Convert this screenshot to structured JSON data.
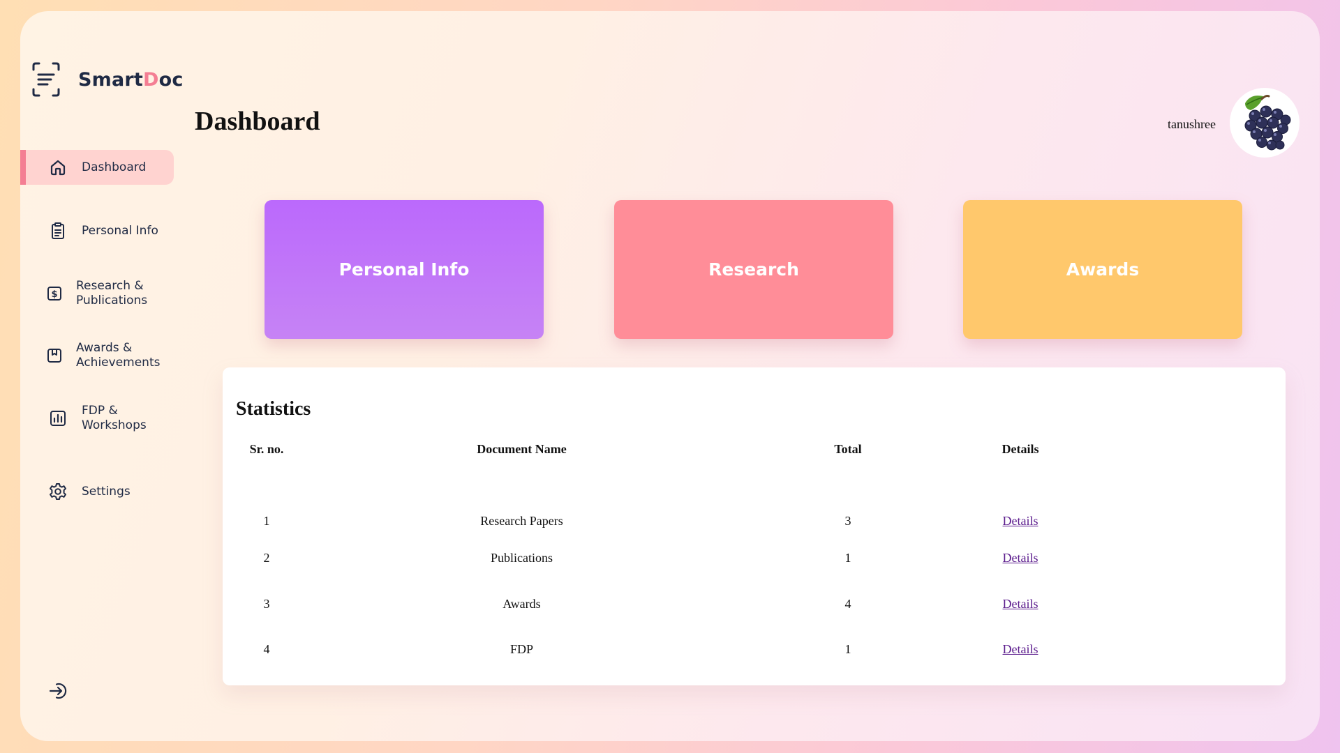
{
  "brand": {
    "name_part1": "Smart",
    "name_accent": "D",
    "name_part2": "oc"
  },
  "sidebar": {
    "items": [
      {
        "label": "Dashboard",
        "icon": "home-icon",
        "active": true
      },
      {
        "label": "Personal Info",
        "icon": "clipboard-icon",
        "active": false
      },
      {
        "label_line1": "Research &",
        "label_line2": "Publications",
        "icon": "dollar-document-icon",
        "active": false
      },
      {
        "label_line1": "Awards &",
        "label_line2": "Achievements",
        "icon": "bookmark-box-icon",
        "active": false
      },
      {
        "label_line1": "FDP &",
        "label_line2": "Workshops",
        "icon": "bar-chart-icon",
        "active": false
      },
      {
        "label": "Settings",
        "icon": "gear-icon",
        "active": false
      }
    ],
    "logout_icon": "logout-icon"
  },
  "header": {
    "title": "Dashboard",
    "username": "tanushree",
    "avatar_icon": "grapes-avatar"
  },
  "cards": [
    {
      "label": "Personal Info",
      "color": "#bb69fc"
    },
    {
      "label": "Research",
      "color": "#ff8d98"
    },
    {
      "label": "Awards",
      "color": "#ffc86c"
    }
  ],
  "statistics": {
    "title": "Statistics",
    "columns": [
      "Sr. no.",
      "Document Name",
      "Total",
      "Details"
    ],
    "rows": [
      {
        "sr": "1",
        "name": "Research Papers",
        "total": "3",
        "details": "Details"
      },
      {
        "sr": "2",
        "name": "Publications",
        "total": "1",
        "details": "Details"
      },
      {
        "sr": "3",
        "name": "Awards",
        "total": "4",
        "details": "Details"
      },
      {
        "sr": "4",
        "name": "FDP",
        "total": "1",
        "details": "Details"
      }
    ]
  },
  "colors": {
    "accent": "#f47e93",
    "active_nav_bg": "#ffd3d0",
    "text_dark": "#1f2a44",
    "link": "#5a1a8c"
  }
}
